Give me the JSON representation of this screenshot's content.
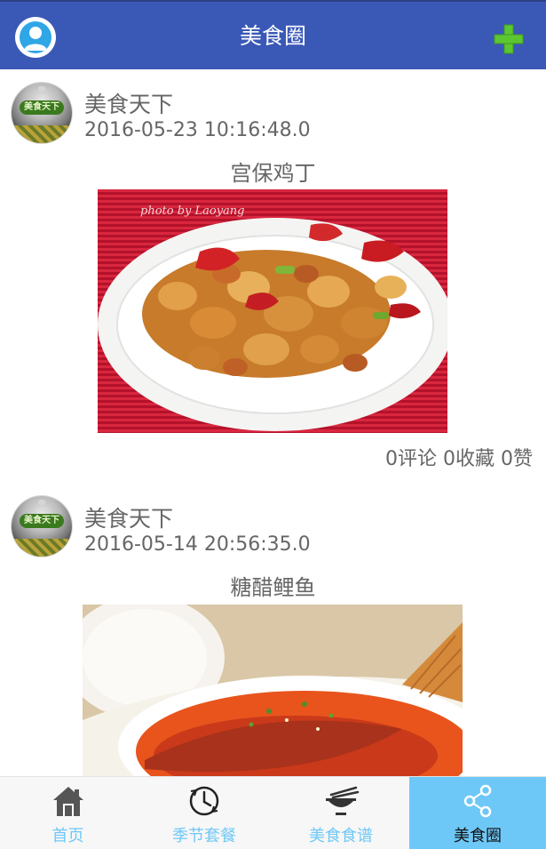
{
  "header": {
    "title": "美食圈",
    "avatar_icon": "user-icon",
    "add_icon": "plus-icon",
    "colors": {
      "bar": "#3a58b6",
      "add": "#5cc632"
    }
  },
  "posts": [
    {
      "author": "美食天下",
      "avatar_text": "美食天下",
      "date": "2016-05-23 10:16:48.0",
      "title": "宫保鸡丁",
      "photo_caption": "photo by Laoyang",
      "stats": "0评论 0收藏 0赞"
    },
    {
      "author": "美食天下",
      "avatar_text": "美食天下",
      "date": "2016-05-14 20:56:35.0",
      "title": "糖醋鲤鱼"
    }
  ],
  "tabs": [
    {
      "label": "首页",
      "icon": "home-icon",
      "active": false
    },
    {
      "label": "季节套餐",
      "icon": "clock-icon",
      "active": false
    },
    {
      "label": "美食食谱",
      "icon": "bowl-icon",
      "active": false
    },
    {
      "label": "美食圈",
      "icon": "share-icon",
      "active": true
    }
  ],
  "colors": {
    "tab_active_bg": "#6ec8f7",
    "tab_label": "#6ec8f7"
  }
}
